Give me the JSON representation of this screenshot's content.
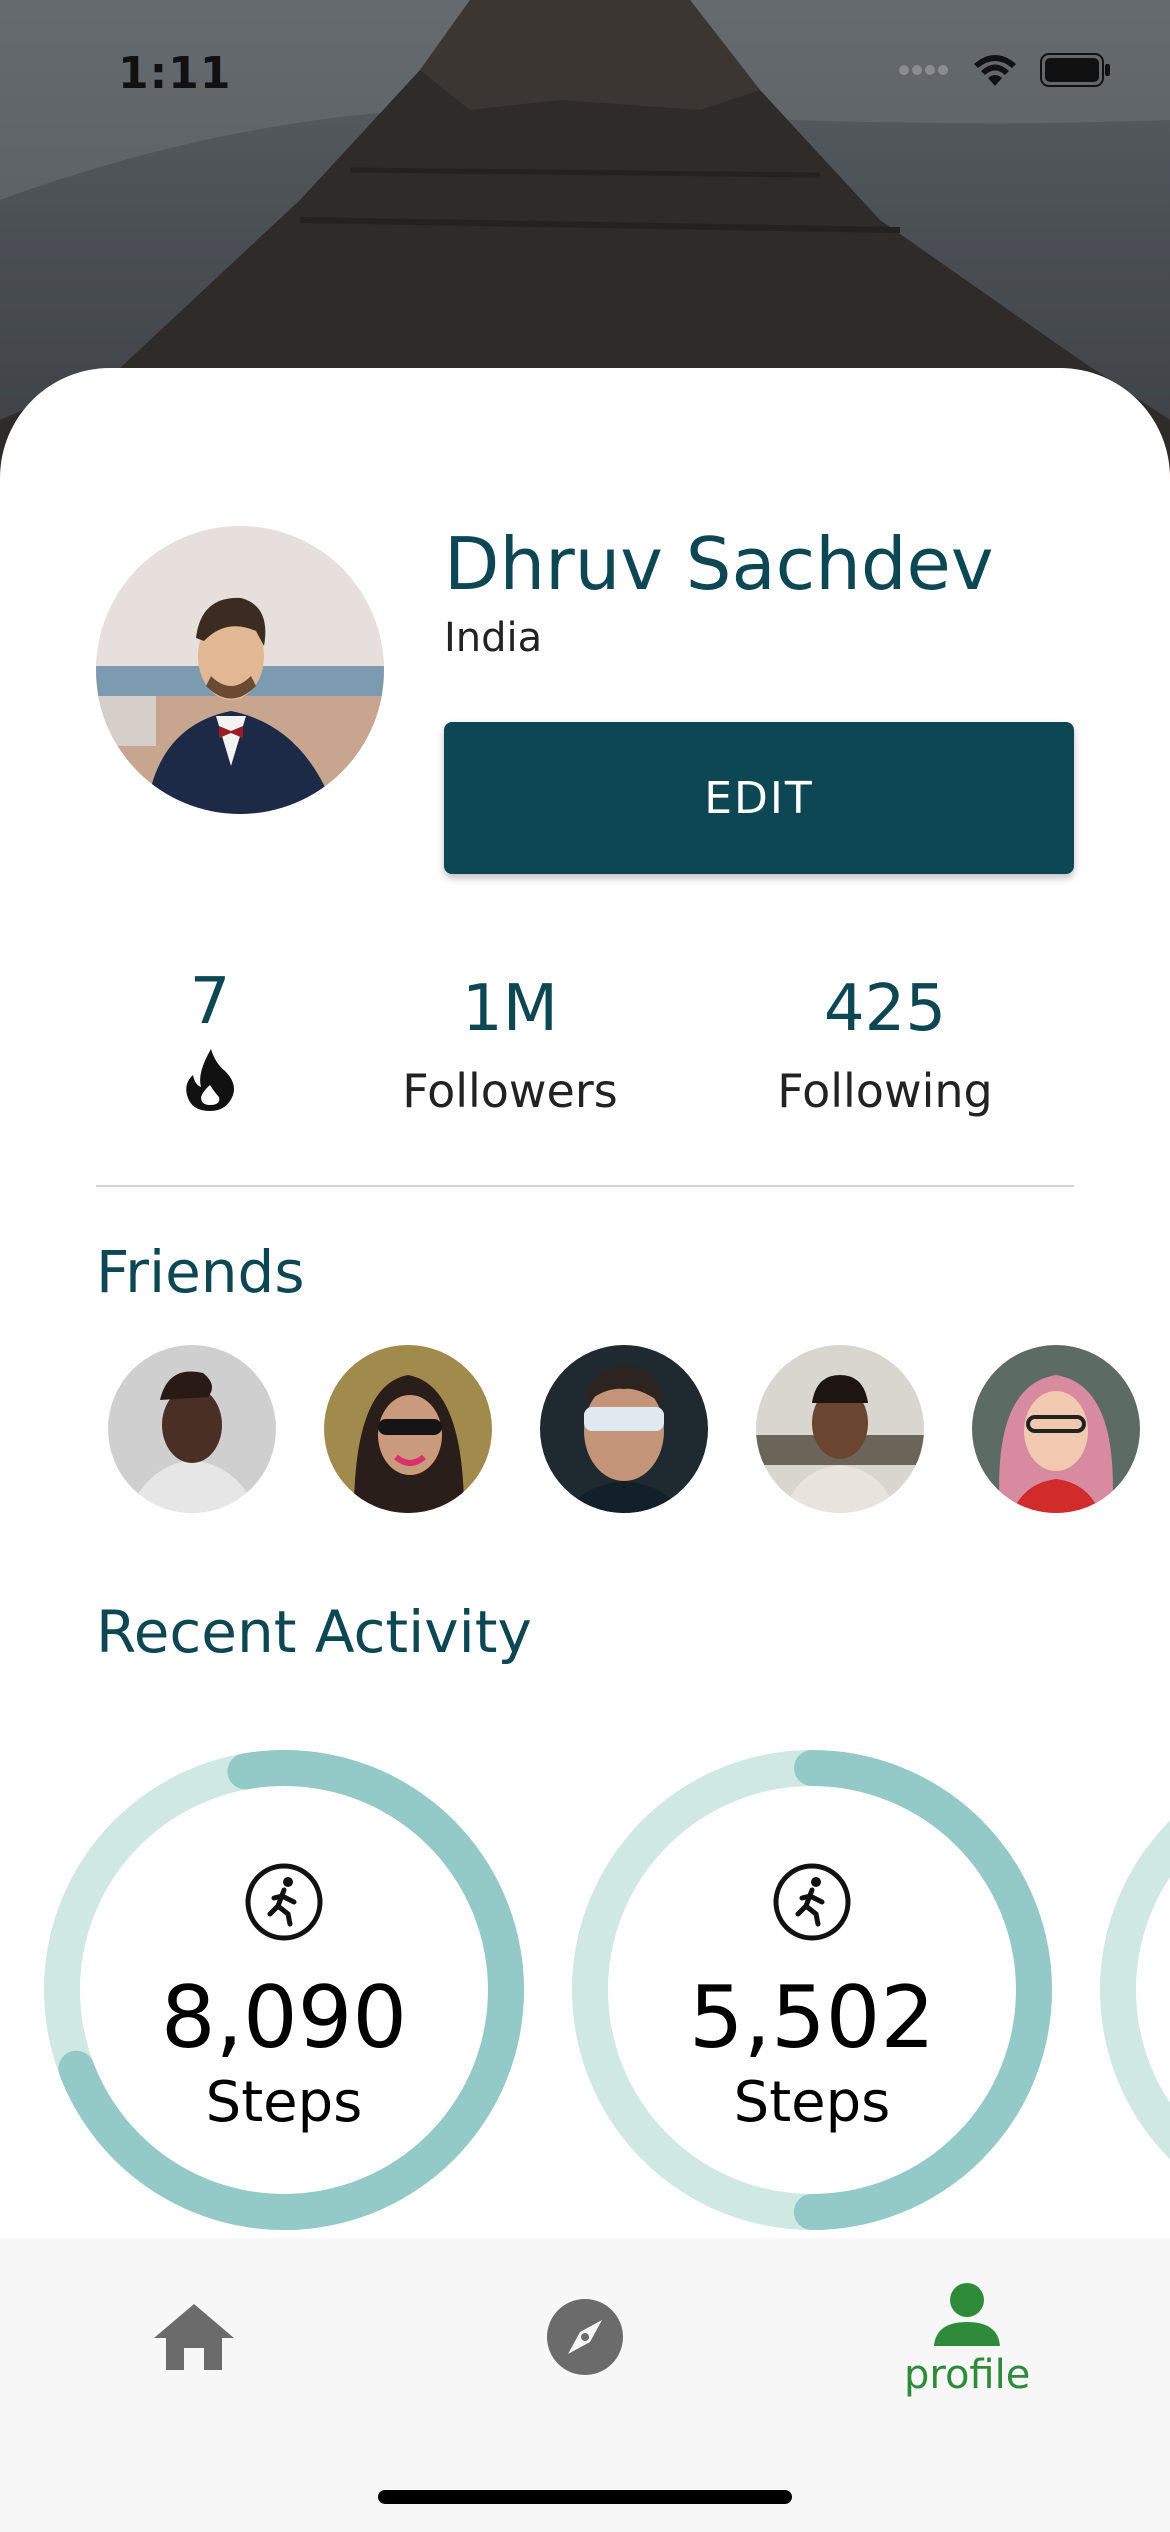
{
  "status_bar": {
    "time": "1:11"
  },
  "profile": {
    "name": "Dhruv Sachdev",
    "country": "India",
    "edit_label": "EDIT"
  },
  "stats": {
    "streak": {
      "value": "7",
      "icon": "flame-icon"
    },
    "followers": {
      "value": "1M",
      "label": "Followers"
    },
    "following": {
      "value": "425",
      "label": "Following"
    }
  },
  "friends": {
    "title": "Friends",
    "count": 5
  },
  "recent_activity": {
    "title": "Recent Activity",
    "items": [
      {
        "value": "8,090",
        "label": "Steps",
        "progress": 0.72
      },
      {
        "value": "5,502",
        "label": "Steps",
        "progress": 0.5
      }
    ]
  },
  "bottom_nav": {
    "items": [
      {
        "icon": "home-icon",
        "label": ""
      },
      {
        "icon": "compass-icon",
        "label": ""
      },
      {
        "icon": "profile-icon",
        "label": "profile",
        "active": true
      }
    ]
  },
  "colors": {
    "primary": "#0d4753",
    "accent_green": "#2e8b3a",
    "ring_track": "#cfe8e1",
    "ring_progress": "#93c9c7"
  }
}
